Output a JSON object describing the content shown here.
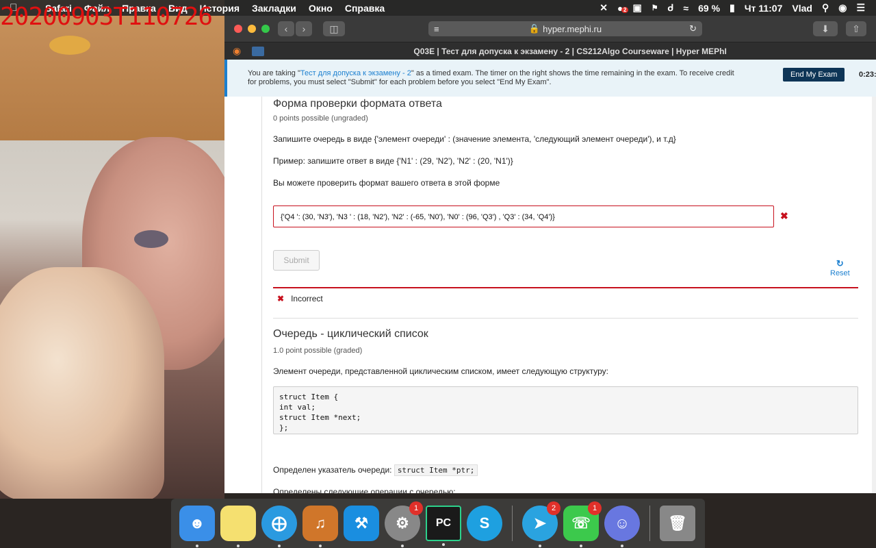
{
  "overlay": {
    "timestamp": "20200903T110726"
  },
  "menubar": {
    "app": "Safari",
    "items": [
      "Файл",
      "Правка",
      "Вид",
      "История",
      "Закладки",
      "Окно",
      "Справка"
    ],
    "notif_badge": "2",
    "battery": "69 %",
    "clock": "Чт 11:07",
    "user": "Vlad"
  },
  "browser": {
    "url": "hyper.mephi.ru",
    "tab_title": "Q03E | Тест для допуска к экзамену - 2 | CS212Algo Courseware | Hyper MEPhI"
  },
  "banner": {
    "text_pre": "You are taking \"",
    "exam_link": "Тест для допуска к экзамену - 2",
    "text_post": "\" as a timed exam. The timer on the right shows the time remaining in the exam. To receive credit for problems, you must select \"Submit\" for each problem before you select \"End My Exam\".",
    "end_button": "End My Exam",
    "timer": "0:23:"
  },
  "problem1": {
    "title": "Форма проверки формата ответа",
    "points": "0 points possible (ungraded)",
    "instruction": "Запишите очередь в виде {'элемент очереди' : (значение элемента, 'следующий элемент очереди'), и т.д}",
    "example": "Пример: запишите ответ в виде {'N1' : (29, 'N2'), 'N2' : (20, 'N1')}",
    "check_note": "Вы можете проверить формат вашего ответа в этой форме",
    "answer_value": "{'Q4 ': (30, 'N3'), 'N3 ' : (18, 'N2'), 'N2' : (-65, 'N0'), 'N0' : (96, 'Q3') , 'Q3' : (34, 'Q4')}",
    "submit_label": "Submit",
    "reset_label": "Reset",
    "status": "Incorrect",
    "status_color": "#c7101d"
  },
  "problem2": {
    "title": "Очередь - циклический список",
    "points": "1.0 point possible (graded)",
    "intro": "Элемент очереди, представленной циклическим списком, имеет следующую структуру:",
    "code": "struct Item {\nint val;\nstruct Item *next;\n};",
    "ptr_text": "Определен указатель очереди: ",
    "ptr_code": "struct Item *ptr;",
    "ops_text": "Определены следующие операции с очередью:"
  },
  "dock": {
    "items": [
      {
        "name": "Finder",
        "icon": "finder-icon",
        "color": "#3a8fe8"
      },
      {
        "name": "Notes",
        "icon": "notes-icon",
        "color": "#f5e070"
      },
      {
        "name": "Safari",
        "icon": "safari-icon",
        "color": "#2a9ae0"
      },
      {
        "name": "GarageBand",
        "icon": "garageband-icon",
        "color": "#d0762a"
      },
      {
        "name": "Xcode",
        "icon": "xcode-icon",
        "color": "#1a8ee0"
      },
      {
        "name": "System Preferences",
        "icon": "gear-icon",
        "color": "#888888",
        "badge": "1"
      },
      {
        "name": "PyCharm",
        "icon": "pycharm-icon",
        "color": "#1a1a1a"
      },
      {
        "name": "Skype",
        "icon": "skype-icon",
        "color": "#1ea0e0"
      },
      {
        "name": "Telegram",
        "icon": "telegram-icon",
        "color": "#2aa3e0",
        "badge": "2"
      },
      {
        "name": "FaceTime",
        "icon": "facetime-icon",
        "color": "#3cc94c",
        "badge": "1"
      },
      {
        "name": "Discord",
        "icon": "discord-icon",
        "color": "#6877e0"
      },
      {
        "name": "Trash",
        "icon": "trash-icon",
        "color": "#888888"
      }
    ]
  }
}
